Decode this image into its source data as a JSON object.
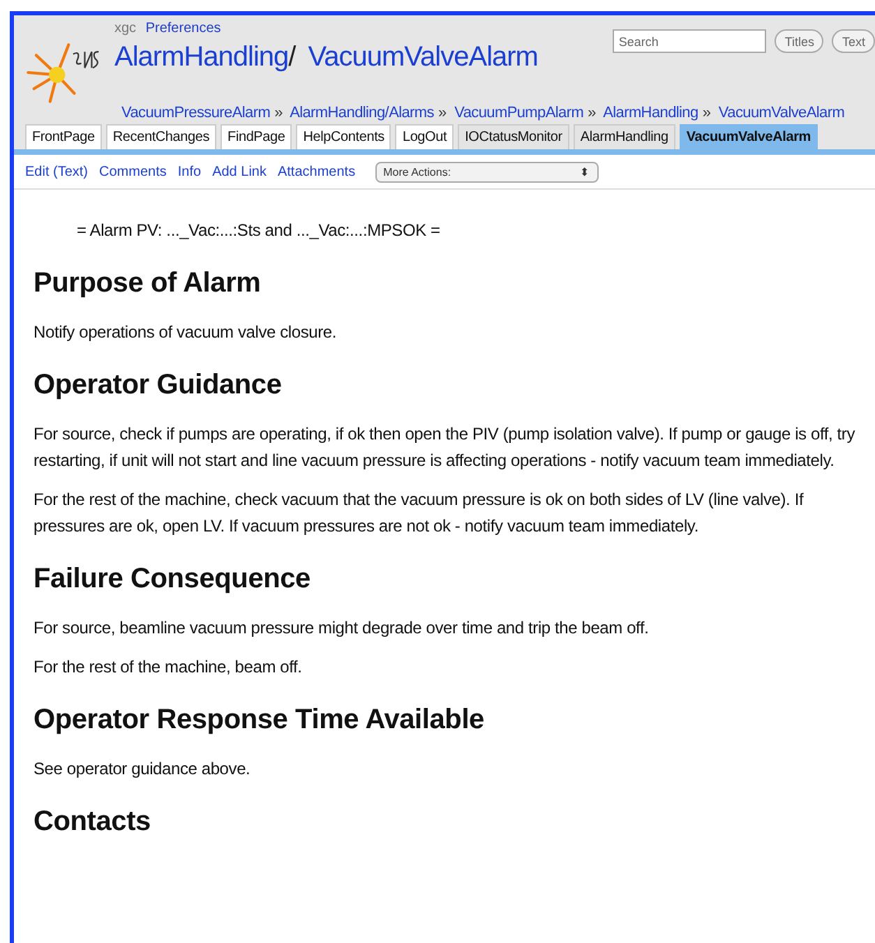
{
  "header": {
    "user": "xgc",
    "preferences_link": "Preferences",
    "title_parent": "AlarmHandling",
    "title_separator": "/",
    "title_page": "VacuumValveAlarm",
    "search": {
      "placeholder": "Search"
    },
    "search_buttons": [
      "Titles",
      "Text"
    ],
    "trail": [
      "VacuumPressureAlarm",
      "AlarmHandling/Alarms",
      "VacuumPumpAlarm",
      "AlarmHandling",
      "VacuumValveAlarm"
    ],
    "trail_separator": "»"
  },
  "tabs": [
    {
      "label": "FrontPage",
      "kind": "nav",
      "selected": false
    },
    {
      "label": "RecentChanges",
      "kind": "nav",
      "selected": false
    },
    {
      "label": "FindPage",
      "kind": "nav",
      "selected": false
    },
    {
      "label": "HelpContents",
      "kind": "nav",
      "selected": false
    },
    {
      "label": "LogOut",
      "kind": "nav",
      "selected": false
    },
    {
      "label": "IOCtatusMonitor",
      "kind": "trail",
      "selected": false
    },
    {
      "label": "AlarmHandling",
      "kind": "trail",
      "selected": false
    },
    {
      "label": "VacuumValveAlarm",
      "kind": "trail",
      "selected": true
    }
  ],
  "actions": [
    "Edit (Text)",
    "Comments",
    "Info",
    "Add Link",
    "Attachments"
  ],
  "more_actions": {
    "value": "More Actions:",
    "caret": "⬍"
  },
  "content": [
    {
      "kind": "pv",
      "text": "= Alarm PV: ..._Vac:...:Sts and ..._Vac:...:MPSOK ="
    },
    {
      "kind": "heading",
      "text": "Purpose of Alarm"
    },
    {
      "kind": "paragraph",
      "text": "Notify operations of vacuum valve closure."
    },
    {
      "kind": "heading",
      "text": "Operator Guidance"
    },
    {
      "kind": "paragraph",
      "text": "For source, check if pumps are operating, if ok then open the PIV (pump isolation valve). If pump or gauge is off, try restarting, if unit will not start and line vacuum pressure is affecting operations - notify vacuum team immediately."
    },
    {
      "kind": "paragraph",
      "text": "For the rest of the machine, check vacuum that the vacuum pressure is ok on both sides of LV (line valve). If pressures are ok, open LV. If vacuum pressures are not ok - notify vacuum team immediately."
    },
    {
      "kind": "heading",
      "text": "Failure Consequence"
    },
    {
      "kind": "paragraph",
      "text": "For source, beamline vacuum pressure might degrade over time and trip the beam off."
    },
    {
      "kind": "paragraph",
      "text": "For the rest of the machine, beam off."
    },
    {
      "kind": "heading",
      "text": "Operator Response Time Available"
    },
    {
      "kind": "paragraph",
      "text": "See operator guidance above."
    },
    {
      "kind": "heading",
      "text": "Contacts"
    }
  ]
}
